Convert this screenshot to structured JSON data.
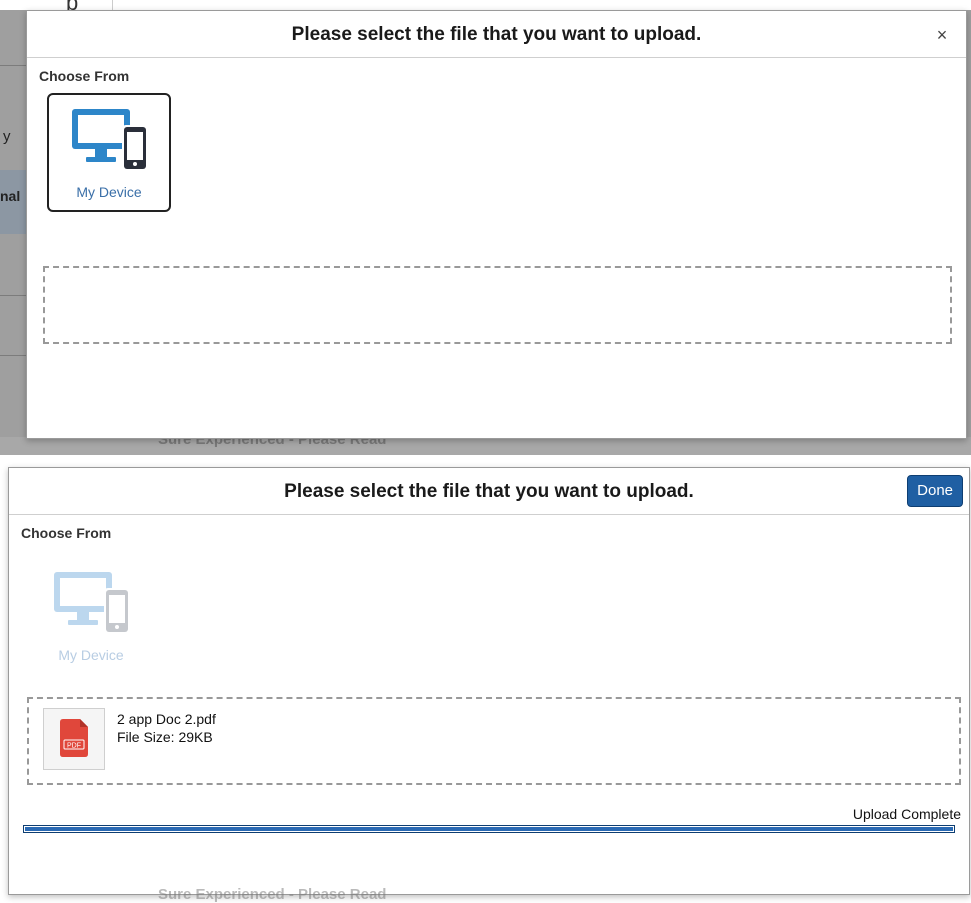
{
  "background": {
    "top_partial_text": "p",
    "left_partial_label_1": "y",
    "left_partial_label_2": "nal",
    "ghost_text": "Sure Experienced - Please Read"
  },
  "dialog_top": {
    "title": "Please select the file that you want to upload.",
    "close_label": "×",
    "choose_from_label": "Choose From",
    "source": {
      "label": "My Device",
      "icon": "desktop-mobile-icon",
      "state": "enabled"
    }
  },
  "dialog_bottom": {
    "title": "Please select the file that you want to upload.",
    "done_label": "Done",
    "choose_from_label": "Choose From",
    "source": {
      "label": "My Device",
      "icon": "desktop-mobile-icon",
      "state": "disabled"
    },
    "file": {
      "icon": "pdf-file-icon",
      "icon_text": "PDF",
      "name": "2 app Doc 2.pdf",
      "size_text": "File Size: 29KB"
    },
    "upload": {
      "status": "Upload Complete",
      "progress_percent": 100
    }
  },
  "colors": {
    "accent_blue": "#1f5fa3",
    "device_icon_blue": "#2d86c9",
    "pdf_red": "#e0473b"
  }
}
